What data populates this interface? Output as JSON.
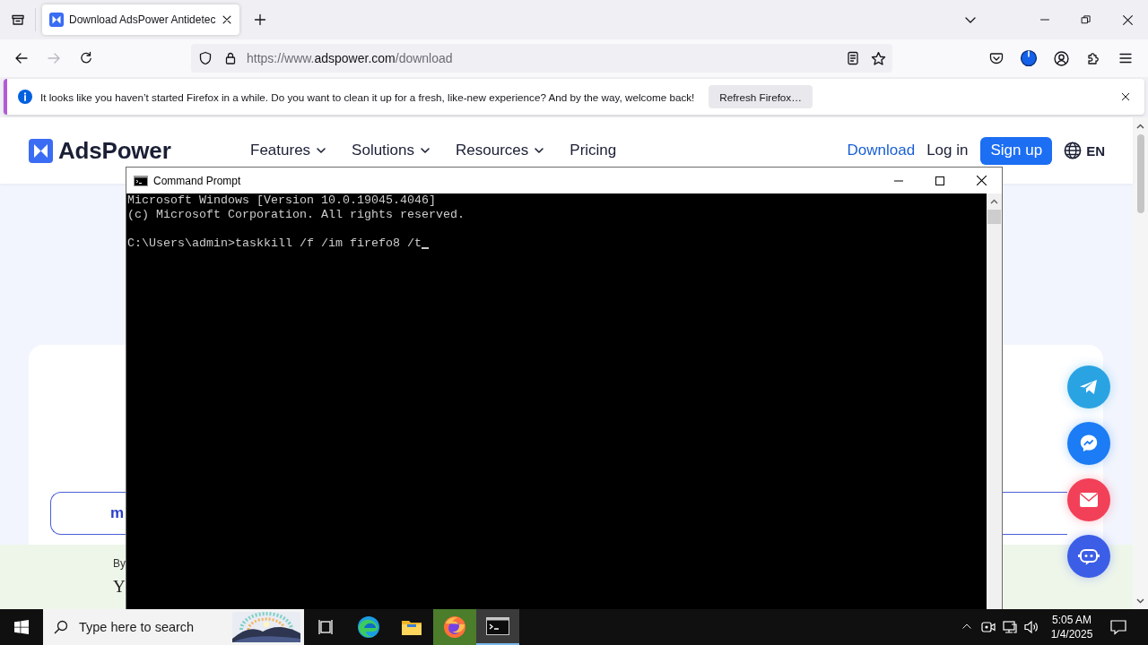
{
  "browser": {
    "tabs": [
      {
        "title": "Download AdsPower Antidetec",
        "selected": true
      }
    ],
    "address": {
      "prefix": "https://www.",
      "domain": "adspower.com",
      "path": "/download"
    },
    "notification": {
      "message": "It looks like you haven’t started Firefox in a while. Do you want to clean it up for a fresh, like-new experience? And by the way, welcome back!",
      "button": "Refresh Firefox…"
    }
  },
  "website": {
    "logo": "AdsPower",
    "nav": [
      {
        "label": "Features",
        "dropdown": true
      },
      {
        "label": "Solutions",
        "dropdown": true
      },
      {
        "label": "Resources",
        "dropdown": true
      },
      {
        "label": "Pricing",
        "dropdown": false
      }
    ],
    "download_link": "Download",
    "login_link": "Log in",
    "signup_button": "Sign up",
    "language": "EN",
    "card_button": "m",
    "footer_lines": [
      "By",
      "Y"
    ],
    "contact_buttons": [
      {
        "kind": "plane",
        "color": "#2aa3e3"
      },
      {
        "kind": "messenger",
        "color": "#1b7cf5"
      },
      {
        "kind": "mail",
        "color": "#f24058"
      },
      {
        "kind": "bot",
        "color": "#3c5ee6"
      }
    ]
  },
  "command_prompt": {
    "title": "Command Prompt",
    "output": [
      "Microsoft Windows [Version 10.0.19045.4046]",
      "(c) Microsoft Corporation. All rights reserved."
    ],
    "input": {
      "text": "C:\\Users\\admin>taskkill /f /im firefo8 /t",
      "cursor": true
    }
  },
  "taskbar": {
    "search": {
      "placeholder": "Type here to search"
    },
    "apps": [
      {
        "kind": "task-view",
        "selected": false,
        "attention": false
      },
      {
        "kind": "edge",
        "selected": false,
        "attention": false
      },
      {
        "kind": "explorer",
        "selected": false,
        "attention": false
      },
      {
        "kind": "firefox",
        "selected": false,
        "attention": true
      },
      {
        "kind": "terminal",
        "selected": true,
        "attention": false
      }
    ],
    "time": "5:05 AM",
    "date": "1/4/2025"
  }
}
